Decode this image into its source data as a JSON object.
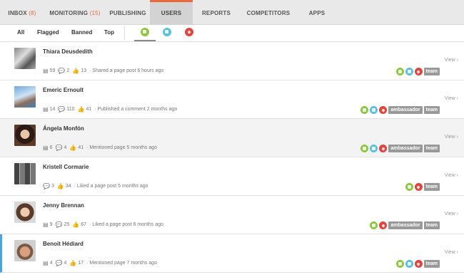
{
  "nav": {
    "tabs": [
      {
        "label": "INBOX",
        "count": "(8)"
      },
      {
        "label": "MONITORING",
        "count": "(15)"
      },
      {
        "label": "PUBLISHING",
        "count": ""
      },
      {
        "label": "USERS",
        "count": ""
      },
      {
        "label": "REPORTS",
        "count": ""
      },
      {
        "label": "COMPETITORS",
        "count": ""
      },
      {
        "label": "APPS",
        "count": ""
      }
    ],
    "active_tab": "USERS",
    "accent_color": "#e8693a"
  },
  "filters": {
    "items": [
      "All",
      "Flagged",
      "Banned",
      "Top"
    ],
    "networks": [
      {
        "icon": "chat-bubble-icon",
        "color": "#8dc63f"
      },
      {
        "icon": "megaphone-icon",
        "color": "#5bc0de"
      },
      {
        "icon": "heart-icon",
        "color": "#e0443c"
      }
    ]
  },
  "users": [
    {
      "name": "Thiara Deusdedith",
      "posts": "59",
      "comments": "2",
      "likes": "13",
      "activity": "Shared a page post 6 hours ago",
      "networks": [
        "green",
        "blue",
        "red"
      ],
      "tags": [
        "team"
      ],
      "view": "View"
    },
    {
      "name": "Emeric Ernoult",
      "posts": "14",
      "comments": "110",
      "likes": "41",
      "activity": "Published a comment 2 months ago",
      "networks": [
        "green",
        "blue",
        "red"
      ],
      "tags": [
        "ambassador",
        "team"
      ],
      "view": "View"
    },
    {
      "name": "Ángela Monfón",
      "posts": "6",
      "comments": "4",
      "likes": "41",
      "activity": "Mentioned page 5 months ago",
      "networks": [
        "green",
        "blue",
        "red"
      ],
      "tags": [
        "ambassador",
        "team"
      ],
      "view": "View"
    },
    {
      "name": "Kristell Cormarie",
      "posts": "",
      "comments": "3",
      "likes": "34",
      "activity": "Liked a page post 5 months ago",
      "networks": [
        "green",
        "red"
      ],
      "tags": [
        "team"
      ],
      "view": "View"
    },
    {
      "name": "Jenny Brennan",
      "posts": "9",
      "comments": "25",
      "likes": "67",
      "activity": "Liked a page post 6 months ago",
      "networks": [
        "green",
        "red"
      ],
      "tags": [
        "ambassador",
        "team"
      ],
      "view": "View"
    },
    {
      "name": "Benoit Hédiard",
      "posts": "4",
      "comments": "4",
      "likes": "17",
      "activity": "Mentioned page 7 months ago",
      "networks": [
        "green",
        "blue",
        "red"
      ],
      "tags": [
        "team"
      ],
      "view": "View"
    }
  ]
}
